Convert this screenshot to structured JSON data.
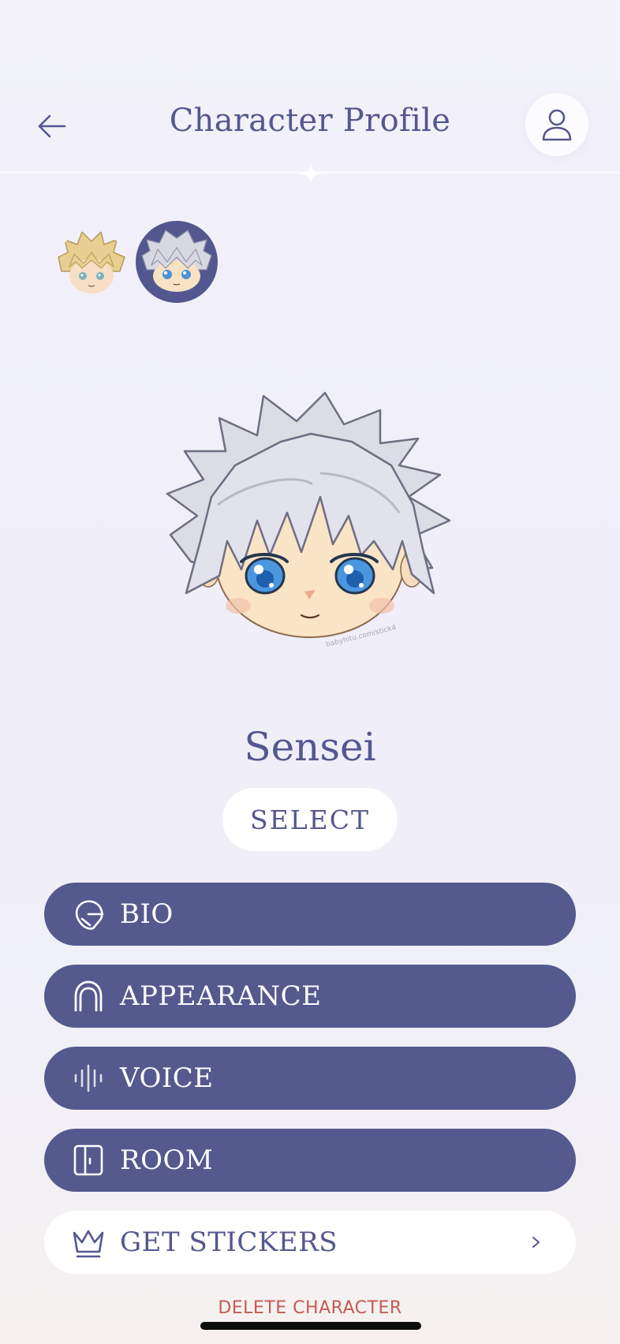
{
  "header": {
    "title": "Character Profile",
    "back_icon": "arrow-left-icon",
    "profile_icon": "user-icon"
  },
  "characters": [
    {
      "name": "blond-spiky-hair-character",
      "selected": false
    },
    {
      "name": "white-hair-character",
      "selected": true
    }
  ],
  "character": {
    "name": "Sensei",
    "portrait_credit": "babyhitu.com/stick4"
  },
  "select_label": "SELECT",
  "menu": [
    {
      "label": "BIO",
      "icon": "bio-icon"
    },
    {
      "label": "APPEARANCE",
      "icon": "hair-icon"
    },
    {
      "label": "VOICE",
      "icon": "voice-wave-icon"
    },
    {
      "label": "ROOM",
      "icon": "door-icon"
    }
  ],
  "stickers": {
    "label": "GET STICKERS",
    "icon": "crown-icon"
  },
  "delete_label": "DELETE CHARACTER",
  "colors": {
    "primary": "#545a8e",
    "text": "#54578f",
    "danger": "#c65a52",
    "background": "#f1f0f8"
  }
}
